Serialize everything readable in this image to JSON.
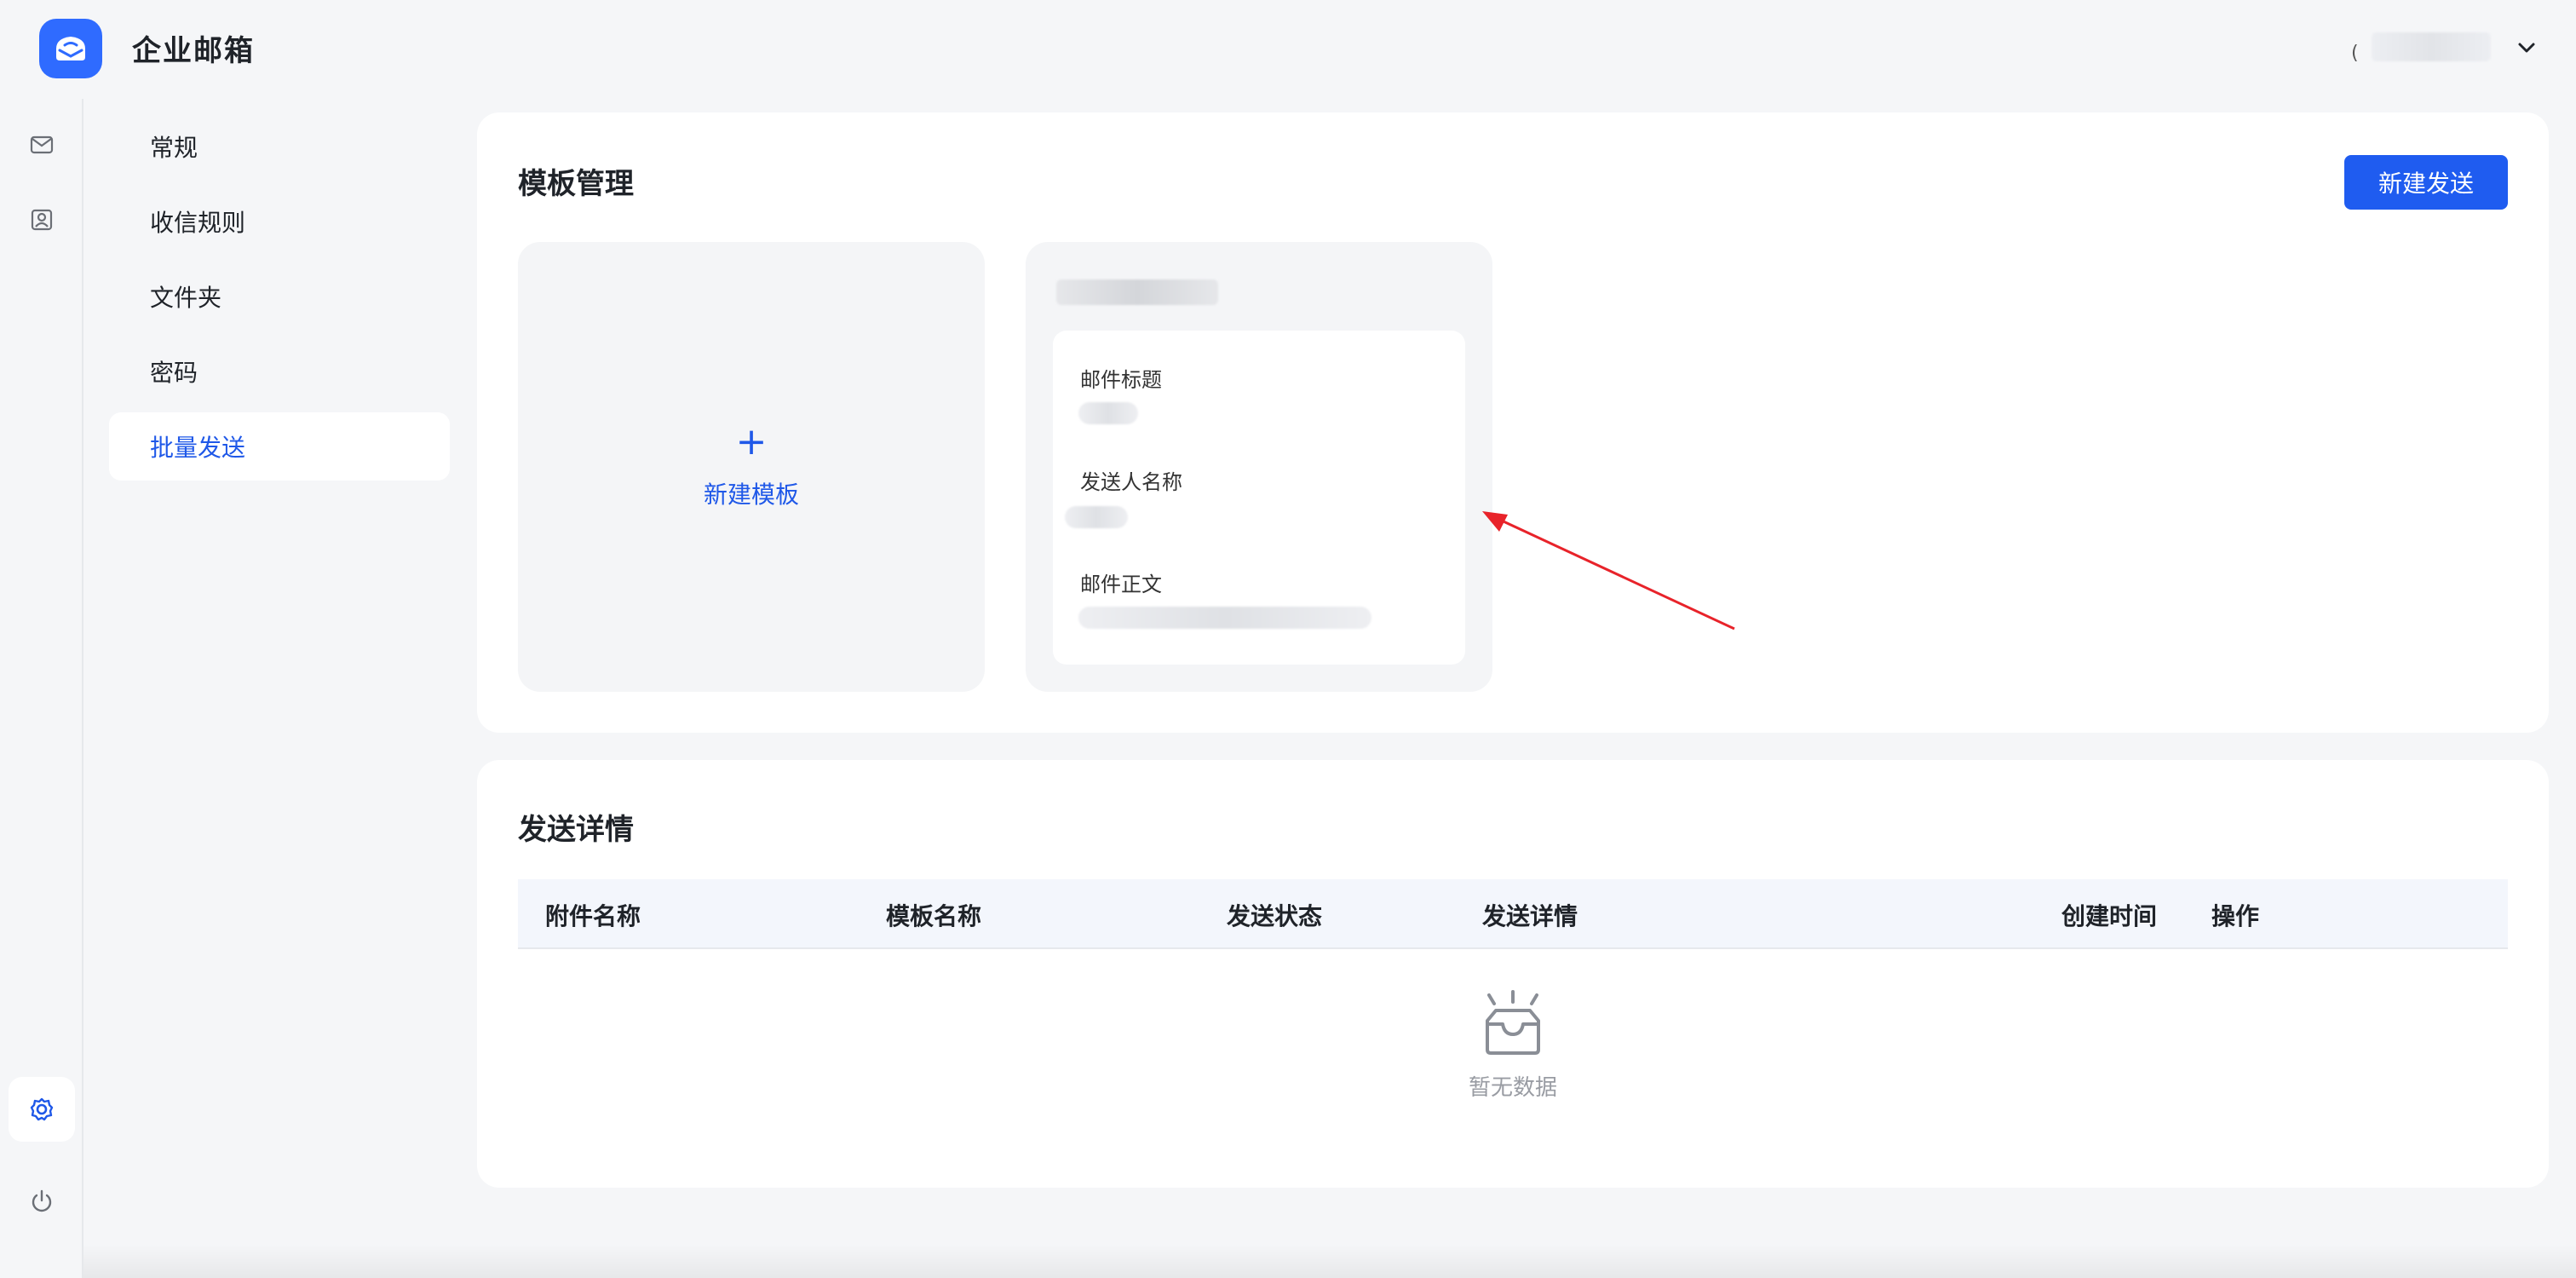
{
  "app": {
    "title": "企业邮箱"
  },
  "header": {
    "user_initial": "("
  },
  "settings_nav": {
    "items": [
      {
        "label": "常规"
      },
      {
        "label": "收信规则"
      },
      {
        "label": "文件夹"
      },
      {
        "label": "密码"
      },
      {
        "label": "批量发送",
        "active": true
      }
    ]
  },
  "template_section": {
    "title": "模板管理",
    "new_send_button": "新建发送",
    "new_template_plus": "+",
    "new_template_label": "新建模板",
    "template_card": {
      "field_subject_label": "邮件标题",
      "field_sender_label": "发送人名称",
      "field_body_label": "邮件正文"
    }
  },
  "details_section": {
    "title": "发送详情",
    "columns": [
      "附件名称",
      "模板名称",
      "发送状态",
      "发送详情",
      "创建时间",
      "操作"
    ],
    "empty_text": "暂无数据"
  },
  "colors": {
    "primary": "#1f5cf0",
    "active_text": "#1f58e8",
    "annotation_arrow": "#e8232a"
  }
}
